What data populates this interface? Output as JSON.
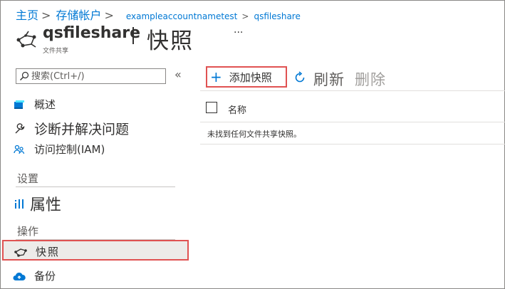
{
  "breadcrumb": {
    "items": [
      "主页",
      "存储帐户",
      "exampleaccountnametest",
      "qsfileshare"
    ],
    "separator": ">"
  },
  "header": {
    "resource_name": "qsfileshare",
    "page_title": "快照",
    "subtitle": "文件共享",
    "more": "···"
  },
  "sidebar": {
    "search_placeholder": "搜索(Ctrl+/)",
    "collapse": "«",
    "items": [
      {
        "label": "概述",
        "icon": "storage-overview-icon"
      },
      {
        "label": "诊断并解决问题",
        "icon": "wrench-icon"
      },
      {
        "label": "访问控制(IAM)",
        "icon": "people-icon"
      }
    ],
    "sections": [
      {
        "title": "设置",
        "items": [
          {
            "label": "属性",
            "icon": "properties-bars-icon"
          }
        ]
      },
      {
        "title": "操作",
        "items": [
          {
            "label": "快照",
            "icon": "snapshot-icon",
            "selected": true
          },
          {
            "label": "备份",
            "icon": "cloud-backup-icon"
          }
        ]
      }
    ]
  },
  "toolbar": {
    "add_label": "添加快照",
    "refresh_label": "刷新",
    "delete_label": "删除"
  },
  "table": {
    "columns": [
      "名称"
    ],
    "empty_message": "未找到任何文件共享快照。"
  },
  "colors": {
    "accent": "#0078d4",
    "highlight_border": "#e05252",
    "selected_bg": "#edebe9",
    "text": "#323130",
    "muted": "#605e5c",
    "disabled": "#a19f9d"
  }
}
